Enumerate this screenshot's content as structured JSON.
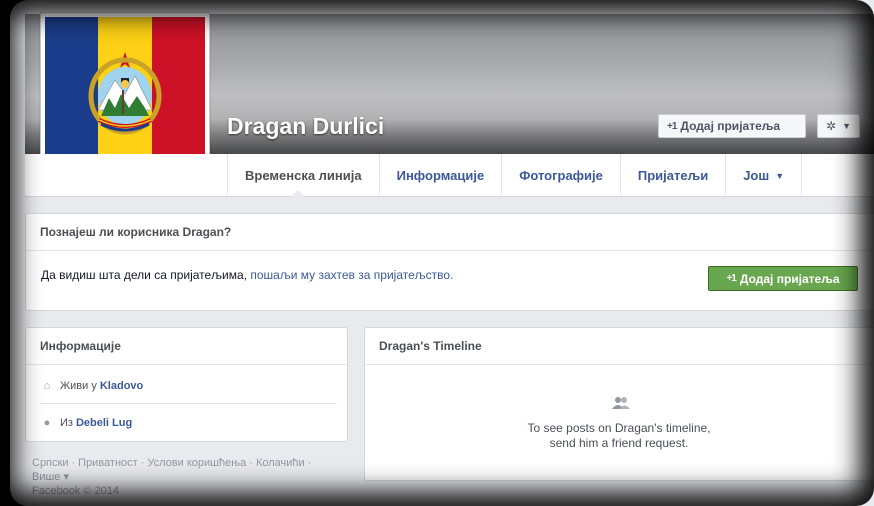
{
  "profile": {
    "name": "Dragan Durlici",
    "add_friend_label": "Додај пријатеља",
    "plus_badge": "+1"
  },
  "tabs": [
    {
      "label": "Временска линија",
      "active": true
    },
    {
      "label": "Информације"
    },
    {
      "label": "Фотографије"
    },
    {
      "label": "Пријатељи"
    },
    {
      "label": "Још"
    }
  ],
  "know": {
    "title": "Познајеш ли корисника Dragan?",
    "text": "Да видиш шта дели са пријатељима,",
    "link": "пошаљи му захтев за пријатељство.",
    "button_label": "Додај пријатеља"
  },
  "info": {
    "title": "Информације",
    "lives_prefix": "Живи у",
    "lives_place": "Kladovo",
    "from_prefix": "Из",
    "from_place": "Debeli Lug"
  },
  "timeline": {
    "title": "Dragan's Timeline",
    "line1": "To see posts on Dragan's timeline,",
    "line2": "send him a friend request."
  },
  "footer": {
    "links": [
      "Српски",
      "Приватност",
      "Услови коришћења",
      "Колачићи"
    ],
    "more": "Више",
    "copyright": "Facebook © 2014"
  },
  "colors": {
    "link_blue": "#3b5998",
    "green_button": "#69a74e",
    "flag_blue": "#1b3c8a",
    "flag_yellow": "#fcd116",
    "flag_red": "#cd1126"
  }
}
